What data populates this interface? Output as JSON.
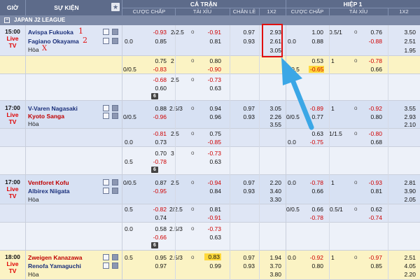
{
  "header": {
    "gio": "GIỜ",
    "su_kien": "SỰ KIỆN",
    "ca_tran": "CẢ TRẬN",
    "hiep1": "HIỆP 1",
    "cuoc_chap": "CƯỢC CHẤP",
    "tai_xiu": "TÀI XỈU",
    "chan_le": "CHẴN LẺ",
    "x12": "1X2",
    "cuoc_chap2": "CƯỢC CHẤP",
    "tai_xiu2": "TÀI XỈU",
    "x12b": "1X2"
  },
  "league": {
    "name": "JAPAN J2 LEAGUE"
  },
  "annotations": {
    "a1": "1",
    "a2": "2",
    "ax": "X"
  },
  "matches": [
    {
      "time": "15:00",
      "live": "Live",
      "tv": "TV",
      "home": "Avispa Fukuoka",
      "away": "Fagiano Okayama",
      "draw": "Hòa",
      "r1": {
        "hdp": "0.0",
        "h1": "-0.93",
        "h2": "0.85",
        "ou": "2/2.5",
        "u1": "o",
        "o1": "-0.91",
        "o2": "0.81",
        "e1": "0.97",
        "e2": "0.93",
        "x1": "2.93",
        "x2": "2.61",
        "x3": "3.05",
        "fhdp": "0.0",
        "fh1": "1.00",
        "fh2": "0.88",
        "fou": "0.5/1",
        "fu": "o",
        "fo1": "0.76",
        "fo2": "-0.88",
        "fx1": "3.50",
        "fx2": "2.51",
        "fx3": "1.95"
      },
      "r2": {
        "hdp": "0/0.5",
        "h1": "0.75",
        "h2": "-0.83",
        "ou": "2",
        "u": "o",
        "o1": "0.80",
        "o2": "-0.90",
        "fhdp": "0/0.5",
        "fh1": "0.53",
        "fh2": "-0.65",
        "fou": "1",
        "fu": "o",
        "fo1": "-0.78",
        "fo2": "0.66"
      },
      "r3": {
        "h1": "-0.68",
        "h2": "0.60",
        "ou": "2.5",
        "u": "o",
        "o1": "-0.73",
        "o2": "0.63",
        "badge": "6"
      }
    },
    {
      "time": "17:00",
      "live": "Live",
      "tv": "TV",
      "home": "V-Varen Nagasaki",
      "away": "Kyoto Sanga",
      "draw": "Hòa",
      "r1": {
        "hdp": "0/0.5",
        "h1": "0.88",
        "h2": "-0.96",
        "ou": "2.5/3",
        "u": "o",
        "o1": "0.94",
        "o2": "0.96",
        "e1": "0.97",
        "e2": "0.93",
        "x1": "3.05",
        "x2": "2.26",
        "x3": "3.55",
        "fhdp": "0/0.5",
        "fh1": "-0.89",
        "fh2": "0.77",
        "fou": "1",
        "fu": "o",
        "fo1": "-0.92",
        "fo2": "0.80",
        "fx1": "3.55",
        "fx2": "2.93",
        "fx3": "2.10"
      },
      "r2": {
        "hdp": "0.0",
        "h1": "-0.81",
        "h2": "0.73",
        "ou": "2.5",
        "u": "o",
        "o1": "0.75",
        "o2": "-0.85",
        "fhdp": "0.0",
        "fh1": "0.63",
        "fh2": "-0.75",
        "fou": "1/1.5",
        "fu": "o",
        "fo1": "-0.80",
        "fo2": "0.68"
      },
      "r3": {
        "hdp": "0.5",
        "h1": "0.70",
        "h2": "-0.78",
        "ou": "3",
        "u": "o",
        "o1": "-0.73",
        "o2": "0.63",
        "badge": "6"
      }
    },
    {
      "time": "17:00",
      "live": "Live",
      "tv": "TV",
      "home": "Ventforet Kofu",
      "away": "Albirex Niigata",
      "draw": "Hòa",
      "r1": {
        "hdp": "0/0.5",
        "h1": "0.87",
        "h2": "-0.95",
        "ou": "2.5",
        "u": "o",
        "o1": "-0.94",
        "o2": "0.84",
        "e1": "0.97",
        "e2": "0.93",
        "x1": "2.20",
        "x2": "3.40",
        "x3": "3.30",
        "fhdp": "0.0",
        "fh1": "-0.78",
        "fh2": "0.66",
        "fou": "1",
        "fu": "o",
        "fo1": "-0.93",
        "fo2": "0.81",
        "fx1": "2.81",
        "fx2": "3.90",
        "fx3": "2.05"
      },
      "r2": {
        "hdp": "0.5",
        "h1": "-0.82",
        "h2": "0.74",
        "ou": "2/2.5",
        "u": "o",
        "o1": "0.81",
        "o2": "-0.91",
        "fhdp": "0/0.5",
        "fh1": "0.66",
        "fh2": "-0.78",
        "fou": "0.5/1",
        "fu": "o",
        "fo1": "0.62",
        "fo2": "-0.74"
      },
      "r3": {
        "hdp": "0.0",
        "h1": "0.58",
        "h2": "-0.66",
        "ou": "2.5/3",
        "u": "o",
        "o1": "-0.73",
        "o2": "0.63",
        "badge": "6"
      }
    },
    {
      "time": "18:00",
      "live": "Live",
      "tv": "TV",
      "home": "Zweigen Kanazawa",
      "away": "Renofa Yamaguchi",
      "draw": "Hòa",
      "r1": {
        "hdp": "0.5",
        "h1": "0.95",
        "h2": "0.97",
        "ou": "2.5/3",
        "u": "o",
        "o1": "0.83",
        "o2": "0.99",
        "e1": "0.97",
        "e2": "0.93",
        "x1": "1.94",
        "x2": "3.70",
        "x3": "3.80",
        "fhdp": "0.0",
        "fh1": "-0.92",
        "fh2": "0.80",
        "fou": "1",
        "fu": "o",
        "fo1": "-0.97",
        "fo2": "0.85",
        "fx1": "2.51",
        "fx2": "4.05",
        "fx3": "2.20"
      }
    }
  ]
}
